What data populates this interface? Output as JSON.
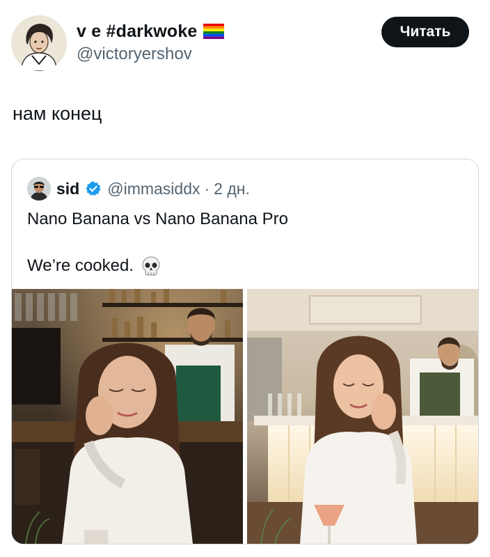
{
  "author": {
    "display_name": "v e #darkwoke",
    "handle": "@victoryershov",
    "flag_icon": "rainbow-flag-icon",
    "avatar_icon": "portrait-avatar"
  },
  "follow_button": {
    "label": "Читать"
  },
  "tweet": {
    "text": "нам конец"
  },
  "quote": {
    "author_name": "sid",
    "verified_icon": "verified-badge-icon",
    "handle": "@immasiddx",
    "separator": "·",
    "time": "2 дн.",
    "line1": "Nano Banana vs Nano Banana Pro",
    "line2": "We’re cooked.",
    "emoji_icon": "skull-icon",
    "media": [
      {
        "name": "nano-banana-image",
        "description_icon": "photo-woman-bar-dark"
      },
      {
        "name": "nano-banana-pro-image",
        "description_icon": "photo-woman-bar-bright"
      }
    ]
  },
  "colors": {
    "text": "#0f1419",
    "secondary": "#536471",
    "border": "#cfd9de",
    "button_bg": "#0f1419",
    "verified": "#1d9bf0"
  }
}
